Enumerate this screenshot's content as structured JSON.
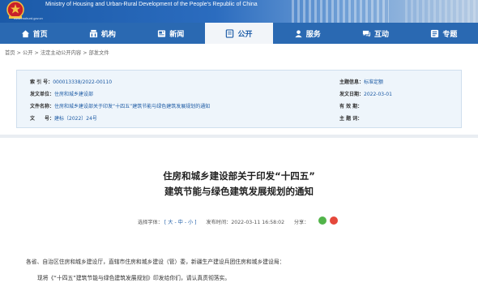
{
  "header": {
    "site_name_en": "Ministry of Housing and Urban-Rural Development of the People's Republic of China",
    "domain": "www.mohurd.gov.cn"
  },
  "nav": [
    {
      "label": "首页",
      "icon": "home-icon"
    },
    {
      "label": "机构",
      "icon": "organization-icon"
    },
    {
      "label": "新闻",
      "icon": "news-icon"
    },
    {
      "label": "公开",
      "icon": "open-info-icon",
      "active": true
    },
    {
      "label": "服务",
      "icon": "service-icon"
    },
    {
      "label": "互动",
      "icon": "interaction-icon"
    },
    {
      "label": "专题",
      "icon": "topic-icon"
    }
  ],
  "breadcrumb": {
    "items": [
      "首页",
      "公开",
      "法定主动公开内容",
      "部发文件"
    ],
    "separator": ">"
  },
  "meta": {
    "index_label": "索 引 号：",
    "index_value": "000013338/2022-00110",
    "issuer_label": "发文单位：",
    "issuer_value": "住房和城乡建设部",
    "filename_label": "文件名称：",
    "filename_value": "住房和城乡建设部关于印发“十四五”建筑节能与绿色建筑发展规划的通知",
    "docno_label": "文　　号：",
    "docno_value": "建标〔2022〕24号",
    "category_label": "主题信息：",
    "category_value": "标准定额",
    "date_label": "发文日期：",
    "date_value": "2022-03-01",
    "validity_label": "有 效 期：",
    "validity_value": "",
    "keywords_label": "主 题 词：",
    "keywords_value": ""
  },
  "article": {
    "title_line1": "住房和城乡建设部关于印发“十四五”",
    "title_line2": "建筑节能与绿色建筑发展规划的通知",
    "font_label": "选择字体：",
    "font_options": [
      "[",
      "大",
      "-",
      "中",
      "-",
      "小",
      "]"
    ],
    "publish_label": "发布时间：",
    "publish_time": "2022-03-11 16:58:02",
    "share_label": "分享：",
    "salutation": "各省、自治区住房和城乡建设厅，直辖市住房和城乡建设（管）委，新疆生产建设兵团住房和城乡建设局：",
    "paragraph1": "现将《“十四五”建筑节能与绿色建筑发展规划》印发给你们，请认真贯彻落实。"
  },
  "colors": {
    "nav_bg": "#2a69b2",
    "nav_active_bg": "#f2f5f9",
    "link": "#1f5ea8",
    "meta_bg": "#eef5fb",
    "wechat": "#52b44a",
    "weibo": "#e5483b"
  }
}
